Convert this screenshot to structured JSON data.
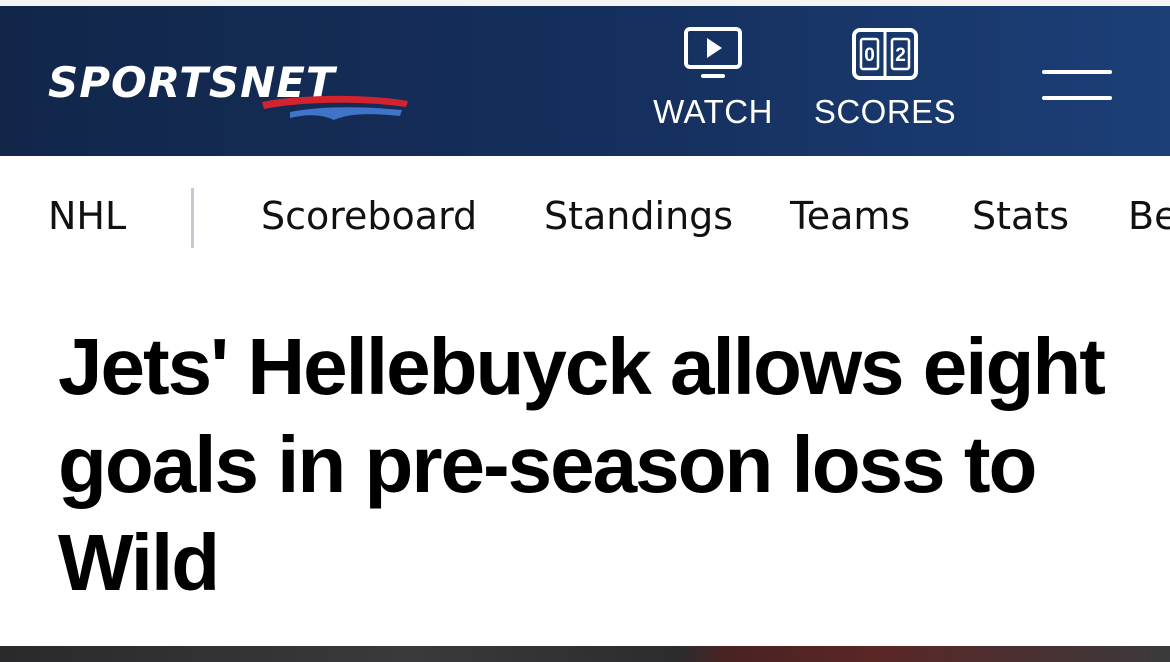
{
  "header": {
    "logo_text": "SPORTSNET",
    "watch_label": "WATCH",
    "scores_label": "SCORES",
    "scores_icon_digits": [
      "0",
      "2"
    ],
    "menu_icon": "hamburger-menu-icon",
    "colors": {
      "background": "#15305e",
      "logo_swoosh_red": "#d3232f",
      "logo_swoosh_blue": "#3f74c9"
    }
  },
  "subnav": {
    "league": "NHL",
    "items": [
      "Scoreboard",
      "Standings",
      "Teams",
      "Stats",
      "Be"
    ]
  },
  "article": {
    "headline": "Jets' Hellebuyck allows eight goals in pre-season loss to Wild"
  }
}
